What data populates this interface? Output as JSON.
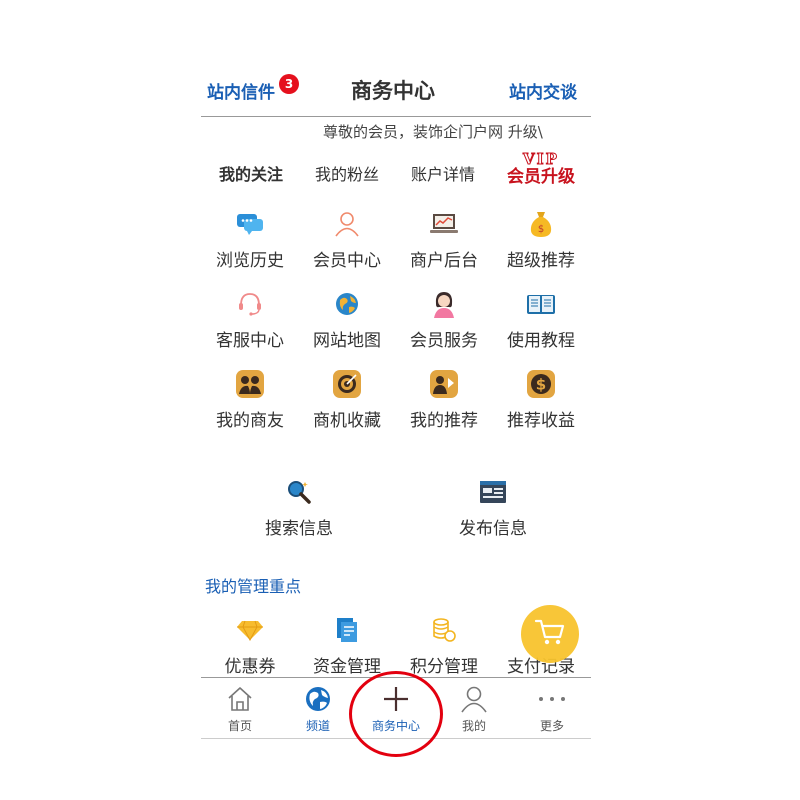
{
  "header": {
    "mailbox_label": "站内信件",
    "mailbox_count": "3",
    "title": "商务中心",
    "chat_label": "站内交谈"
  },
  "notice": "尊敬的会员，装饰企门户网 升级\\",
  "tabs": [
    "我的关注",
    "我的粉丝",
    "账户详情"
  ],
  "vip": {
    "line1": "VIP",
    "line2": "会员升级"
  },
  "grid": [
    {
      "label": "浏览历史",
      "icon": "chat-bubbles-icon"
    },
    {
      "label": "会员中心",
      "icon": "user-outline-icon"
    },
    {
      "label": "商户后台",
      "icon": "laptop-chart-icon"
    },
    {
      "label": "超级推荐",
      "icon": "money-bag-icon"
    },
    {
      "label": "客服中心",
      "icon": "headset-icon"
    },
    {
      "label": "网站地图",
      "icon": "globe-icon"
    },
    {
      "label": "会员服务",
      "icon": "service-agent-icon"
    },
    {
      "label": "使用教程",
      "icon": "open-book-icon"
    },
    {
      "label": "我的商友",
      "icon": "friends-icon"
    },
    {
      "label": "商机收藏",
      "icon": "target-icon"
    },
    {
      "label": "我的推荐",
      "icon": "recommend-icon"
    },
    {
      "label": "推荐收益",
      "icon": "dollar-coin-icon"
    }
  ],
  "actions": [
    {
      "label": "搜索信息",
      "icon": "magnifier-icon"
    },
    {
      "label": "发布信息",
      "icon": "publish-window-icon"
    }
  ],
  "section_title": "我的管理重点",
  "manage": [
    {
      "label": "优惠券",
      "icon": "diamond-icon"
    },
    {
      "label": "资金管理",
      "icon": "finance-doc-icon"
    },
    {
      "label": "积分管理",
      "icon": "coin-stack-icon"
    },
    {
      "label": "支付记录",
      "icon": "cart-icon"
    }
  ],
  "nav": [
    {
      "label": "首页",
      "icon": "home-icon"
    },
    {
      "label": "频道",
      "icon": "globe-icon"
    },
    {
      "label": "商务中心",
      "icon": "plus-icon"
    },
    {
      "label": "我的",
      "icon": "user-icon"
    },
    {
      "label": "更多",
      "icon": "more-dots-icon"
    }
  ],
  "colors": {
    "accent": "#1a5fb4",
    "badge": "#e5101d",
    "cart": "#f8c42e",
    "highlight_ring": "#e3000f"
  }
}
